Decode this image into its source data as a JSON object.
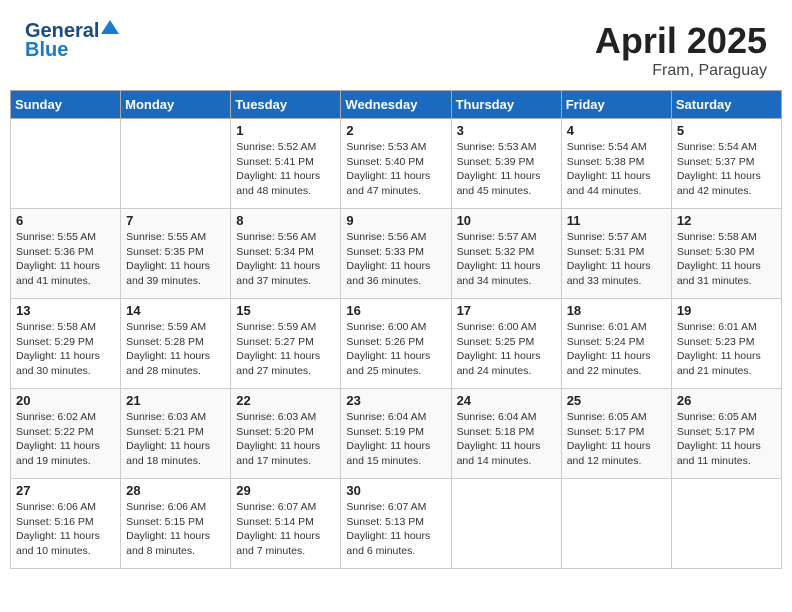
{
  "header": {
    "logo_general": "General",
    "logo_blue": "Blue",
    "month_title": "April 2025",
    "location": "Fram, Paraguay"
  },
  "days_of_week": [
    "Sunday",
    "Monday",
    "Tuesday",
    "Wednesday",
    "Thursday",
    "Friday",
    "Saturday"
  ],
  "weeks": [
    [
      {
        "day": "",
        "info": ""
      },
      {
        "day": "",
        "info": ""
      },
      {
        "day": "1",
        "sunrise": "Sunrise: 5:52 AM",
        "sunset": "Sunset: 5:41 PM",
        "daylight": "Daylight: 11 hours and 48 minutes."
      },
      {
        "day": "2",
        "sunrise": "Sunrise: 5:53 AM",
        "sunset": "Sunset: 5:40 PM",
        "daylight": "Daylight: 11 hours and 47 minutes."
      },
      {
        "day": "3",
        "sunrise": "Sunrise: 5:53 AM",
        "sunset": "Sunset: 5:39 PM",
        "daylight": "Daylight: 11 hours and 45 minutes."
      },
      {
        "day": "4",
        "sunrise": "Sunrise: 5:54 AM",
        "sunset": "Sunset: 5:38 PM",
        "daylight": "Daylight: 11 hours and 44 minutes."
      },
      {
        "day": "5",
        "sunrise": "Sunrise: 5:54 AM",
        "sunset": "Sunset: 5:37 PM",
        "daylight": "Daylight: 11 hours and 42 minutes."
      }
    ],
    [
      {
        "day": "6",
        "sunrise": "Sunrise: 5:55 AM",
        "sunset": "Sunset: 5:36 PM",
        "daylight": "Daylight: 11 hours and 41 minutes."
      },
      {
        "day": "7",
        "sunrise": "Sunrise: 5:55 AM",
        "sunset": "Sunset: 5:35 PM",
        "daylight": "Daylight: 11 hours and 39 minutes."
      },
      {
        "day": "8",
        "sunrise": "Sunrise: 5:56 AM",
        "sunset": "Sunset: 5:34 PM",
        "daylight": "Daylight: 11 hours and 37 minutes."
      },
      {
        "day": "9",
        "sunrise": "Sunrise: 5:56 AM",
        "sunset": "Sunset: 5:33 PM",
        "daylight": "Daylight: 11 hours and 36 minutes."
      },
      {
        "day": "10",
        "sunrise": "Sunrise: 5:57 AM",
        "sunset": "Sunset: 5:32 PM",
        "daylight": "Daylight: 11 hours and 34 minutes."
      },
      {
        "day": "11",
        "sunrise": "Sunrise: 5:57 AM",
        "sunset": "Sunset: 5:31 PM",
        "daylight": "Daylight: 11 hours and 33 minutes."
      },
      {
        "day": "12",
        "sunrise": "Sunrise: 5:58 AM",
        "sunset": "Sunset: 5:30 PM",
        "daylight": "Daylight: 11 hours and 31 minutes."
      }
    ],
    [
      {
        "day": "13",
        "sunrise": "Sunrise: 5:58 AM",
        "sunset": "Sunset: 5:29 PM",
        "daylight": "Daylight: 11 hours and 30 minutes."
      },
      {
        "day": "14",
        "sunrise": "Sunrise: 5:59 AM",
        "sunset": "Sunset: 5:28 PM",
        "daylight": "Daylight: 11 hours and 28 minutes."
      },
      {
        "day": "15",
        "sunrise": "Sunrise: 5:59 AM",
        "sunset": "Sunset: 5:27 PM",
        "daylight": "Daylight: 11 hours and 27 minutes."
      },
      {
        "day": "16",
        "sunrise": "Sunrise: 6:00 AM",
        "sunset": "Sunset: 5:26 PM",
        "daylight": "Daylight: 11 hours and 25 minutes."
      },
      {
        "day": "17",
        "sunrise": "Sunrise: 6:00 AM",
        "sunset": "Sunset: 5:25 PM",
        "daylight": "Daylight: 11 hours and 24 minutes."
      },
      {
        "day": "18",
        "sunrise": "Sunrise: 6:01 AM",
        "sunset": "Sunset: 5:24 PM",
        "daylight": "Daylight: 11 hours and 22 minutes."
      },
      {
        "day": "19",
        "sunrise": "Sunrise: 6:01 AM",
        "sunset": "Sunset: 5:23 PM",
        "daylight": "Daylight: 11 hours and 21 minutes."
      }
    ],
    [
      {
        "day": "20",
        "sunrise": "Sunrise: 6:02 AM",
        "sunset": "Sunset: 5:22 PM",
        "daylight": "Daylight: 11 hours and 19 minutes."
      },
      {
        "day": "21",
        "sunrise": "Sunrise: 6:03 AM",
        "sunset": "Sunset: 5:21 PM",
        "daylight": "Daylight: 11 hours and 18 minutes."
      },
      {
        "day": "22",
        "sunrise": "Sunrise: 6:03 AM",
        "sunset": "Sunset: 5:20 PM",
        "daylight": "Daylight: 11 hours and 17 minutes."
      },
      {
        "day": "23",
        "sunrise": "Sunrise: 6:04 AM",
        "sunset": "Sunset: 5:19 PM",
        "daylight": "Daylight: 11 hours and 15 minutes."
      },
      {
        "day": "24",
        "sunrise": "Sunrise: 6:04 AM",
        "sunset": "Sunset: 5:18 PM",
        "daylight": "Daylight: 11 hours and 14 minutes."
      },
      {
        "day": "25",
        "sunrise": "Sunrise: 6:05 AM",
        "sunset": "Sunset: 5:17 PM",
        "daylight": "Daylight: 11 hours and 12 minutes."
      },
      {
        "day": "26",
        "sunrise": "Sunrise: 6:05 AM",
        "sunset": "Sunset: 5:17 PM",
        "daylight": "Daylight: 11 hours and 11 minutes."
      }
    ],
    [
      {
        "day": "27",
        "sunrise": "Sunrise: 6:06 AM",
        "sunset": "Sunset: 5:16 PM",
        "daylight": "Daylight: 11 hours and 10 minutes."
      },
      {
        "day": "28",
        "sunrise": "Sunrise: 6:06 AM",
        "sunset": "Sunset: 5:15 PM",
        "daylight": "Daylight: 11 hours and 8 minutes."
      },
      {
        "day": "29",
        "sunrise": "Sunrise: 6:07 AM",
        "sunset": "Sunset: 5:14 PM",
        "daylight": "Daylight: 11 hours and 7 minutes."
      },
      {
        "day": "30",
        "sunrise": "Sunrise: 6:07 AM",
        "sunset": "Sunset: 5:13 PM",
        "daylight": "Daylight: 11 hours and 6 minutes."
      },
      {
        "day": "",
        "info": ""
      },
      {
        "day": "",
        "info": ""
      },
      {
        "day": "",
        "info": ""
      }
    ]
  ]
}
